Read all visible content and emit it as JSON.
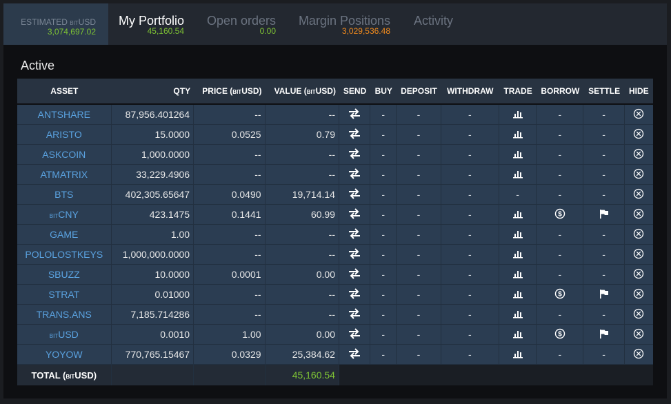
{
  "tabs": {
    "estimated": {
      "label_pre": "ESTIMATED ",
      "label_small": "BIT",
      "label_post": "USD",
      "value": "3,074,697.02"
    },
    "portfolio": {
      "label": "My Portfolio",
      "value": "45,160.54"
    },
    "open_orders": {
      "label": "Open orders",
      "value": "0.00"
    },
    "margin": {
      "label": "Margin Positions",
      "value": "3,029,536.48"
    },
    "activity": {
      "label": "Activity"
    }
  },
  "section_title": "Active",
  "columns": {
    "asset": "ASSET",
    "qty": "QTY",
    "price_pre": "PRICE (",
    "price_small": "BIT",
    "price_post": "USD)",
    "value_pre": "VALUE (",
    "value_small": "BIT",
    "value_post": "USD)",
    "send": "SEND",
    "buy": "BUY",
    "deposit": "DEPOSIT",
    "withdraw": "WITHDRAW",
    "trade": "TRADE",
    "borrow": "BORROW",
    "settle": "SETTLE",
    "hide": "HIDE"
  },
  "rows": [
    {
      "prefix": "",
      "name": "ANTSHARE",
      "qty": "87,956.401264",
      "price": "--",
      "value": "--",
      "buy": "-",
      "deposit": "-",
      "withdraw": "-",
      "trade": "chart-icon",
      "borrow": "-",
      "settle": "-"
    },
    {
      "prefix": "",
      "name": "ARISTO",
      "qty": "15.0000",
      "price": "0.0525",
      "value": "0.79",
      "buy": "-",
      "deposit": "-",
      "withdraw": "-",
      "trade": "chart-icon",
      "borrow": "-",
      "settle": "-"
    },
    {
      "prefix": "",
      "name": "ASKCOIN",
      "qty": "1,000.0000",
      "price": "--",
      "value": "--",
      "buy": "-",
      "deposit": "-",
      "withdraw": "-",
      "trade": "chart-icon",
      "borrow": "-",
      "settle": "-"
    },
    {
      "prefix": "",
      "name": "ATMATRIX",
      "qty": "33,229.4906",
      "price": "--",
      "value": "--",
      "buy": "-",
      "deposit": "-",
      "withdraw": "-",
      "trade": "chart-icon",
      "borrow": "-",
      "settle": "-"
    },
    {
      "prefix": "",
      "name": "BTS",
      "qty": "402,305.65647",
      "price": "0.0490",
      "value": "19,714.14",
      "buy": "-",
      "deposit": "-",
      "withdraw": "-",
      "trade": "-",
      "borrow": "-",
      "settle": "-"
    },
    {
      "prefix": "BIT",
      "name": "CNY",
      "qty": "423.1475",
      "price": "0.1441",
      "value": "60.99",
      "buy": "-",
      "deposit": "-",
      "withdraw": "-",
      "trade": "chart-icon",
      "borrow": "dollar-icon",
      "settle": "flag-icon"
    },
    {
      "prefix": "",
      "name": "GAME",
      "qty": "1.00",
      "price": "--",
      "value": "--",
      "buy": "-",
      "deposit": "-",
      "withdraw": "-",
      "trade": "chart-icon",
      "borrow": "-",
      "settle": "-"
    },
    {
      "prefix": "",
      "name": "POLOLOSTKEYS",
      "qty": "1,000,000.0000",
      "price": "--",
      "value": "--",
      "buy": "-",
      "deposit": "-",
      "withdraw": "-",
      "trade": "chart-icon",
      "borrow": "-",
      "settle": "-"
    },
    {
      "prefix": "",
      "name": "SBUZZ",
      "qty": "10.0000",
      "price": "0.0001",
      "value": "0.00",
      "buy": "-",
      "deposit": "-",
      "withdraw": "-",
      "trade": "chart-icon",
      "borrow": "-",
      "settle": "-"
    },
    {
      "prefix": "",
      "name": "STRAT",
      "qty": "0.01000",
      "price": "--",
      "value": "--",
      "buy": "-",
      "deposit": "-",
      "withdraw": "-",
      "trade": "chart-icon",
      "borrow": "dollar-icon",
      "settle": "flag-icon"
    },
    {
      "prefix": "",
      "name": "TRANS.ANS",
      "qty": "7,185.714286",
      "price": "--",
      "value": "--",
      "buy": "-",
      "deposit": "-",
      "withdraw": "-",
      "trade": "chart-icon",
      "borrow": "-",
      "settle": "-"
    },
    {
      "prefix": "BIT",
      "name": "USD",
      "qty": "0.0010",
      "price": "1.00",
      "value": "0.00",
      "buy": "-",
      "deposit": "-",
      "withdraw": "-",
      "trade": "chart-icon",
      "borrow": "dollar-icon",
      "settle": "flag-icon"
    },
    {
      "prefix": "",
      "name": "YOYOW",
      "qty": "770,765.15467",
      "price": "0.0329",
      "value": "25,384.62",
      "buy": "-",
      "deposit": "-",
      "withdraw": "-",
      "trade": "chart-icon",
      "borrow": "-",
      "settle": "-"
    }
  ],
  "total": {
    "label_pre": "TOTAL (",
    "label_small": "BIT",
    "label_post": "USD)",
    "value": "45,160.54"
  },
  "colors": {
    "accent_green": "#7fc434",
    "accent_orange": "#f08a1d",
    "link_blue": "#5aa2e0",
    "row_bg": "#2b3d52",
    "header_bg": "#283341"
  }
}
